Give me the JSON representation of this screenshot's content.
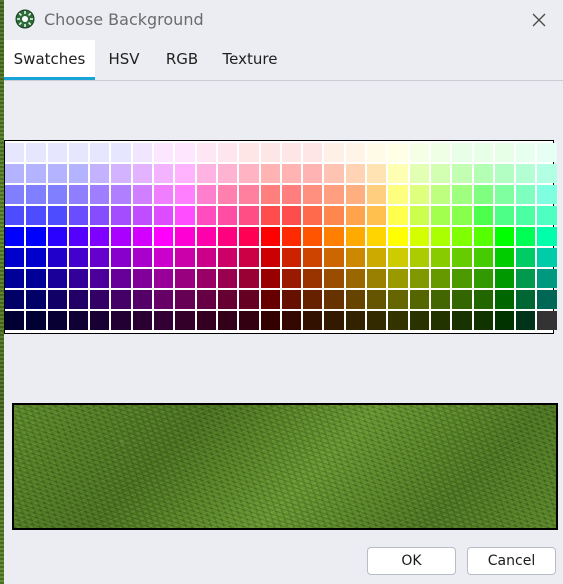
{
  "window": {
    "title": "Choose Background",
    "icon": "gear-app-icon",
    "close_icon": "close-icon"
  },
  "tabs": [
    {
      "label": "Swatches",
      "active": true
    },
    {
      "label": "HSV",
      "active": false
    },
    {
      "label": "RGB",
      "active": false
    },
    {
      "label": "Texture",
      "active": false
    }
  ],
  "swatches": {
    "rows": 9,
    "columns": 26,
    "colors": [
      [
        "#e6e6ff",
        "#e6e6ff",
        "#e6e6ff",
        "#e6e6ff",
        "#e6e6ff",
        "#e6e6ff",
        "#f0e6ff",
        "#fde6ff",
        "#ffe6ff",
        "#ffe6f5",
        "#ffe6ee",
        "#ffe6e6",
        "#ffe6e6",
        "#ffe6e6",
        "#ffe6e6",
        "#fff0e6",
        "#fff5e6",
        "#fffbe6",
        "#ffffe6",
        "#f5ffe6",
        "#eeffe6",
        "#e6ffe6",
        "#e6ffe6",
        "#e6ffe6",
        "#e6ffee",
        "#e6fff5"
      ],
      [
        "#b3b3ff",
        "#b3b3ff",
        "#b3b3ff",
        "#b3b3ff",
        "#c3b3ff",
        "#d3b3ff",
        "#e3b3ff",
        "#f3b3ff",
        "#ffb3ff",
        "#ffb3e3",
        "#ffb3d3",
        "#ffb3c3",
        "#ffb3b3",
        "#ffb3b3",
        "#ffb3b3",
        "#ffc3b3",
        "#ffd3b3",
        "#ffe3b3",
        "#ffffb3",
        "#e3ffb3",
        "#d3ffb3",
        "#c3ffb3",
        "#b3ffb3",
        "#b3ffc3",
        "#b3ffd3",
        "#b3ffe3"
      ],
      [
        "#7f7fff",
        "#7f7fff",
        "#7f7fff",
        "#8f7fff",
        "#9f7fff",
        "#af7fff",
        "#cf7fff",
        "#ef7fff",
        "#ff7fff",
        "#ff7fcf",
        "#ff7faf",
        "#ff7f9f",
        "#ff7f7f",
        "#ff7f7f",
        "#ff8f7f",
        "#ff9f7f",
        "#ffaf7f",
        "#ffcf7f",
        "#ffff7f",
        "#dfff7f",
        "#bfff7f",
        "#9fff7f",
        "#7fff7f",
        "#7fff9f",
        "#7fffbf",
        "#7fffdf"
      ],
      [
        "#4d4dff",
        "#4d4dff",
        "#4d4dff",
        "#6a4dff",
        "#864dff",
        "#a34dff",
        "#c04dff",
        "#dd4dff",
        "#ff4dff",
        "#ff4dc0",
        "#ff4da3",
        "#ff4d86",
        "#ff4d4d",
        "#ff4d4d",
        "#ff6a4d",
        "#ff864d",
        "#ffa34d",
        "#ffc04d",
        "#ffff4d",
        "#ccff4d",
        "#a3ff4d",
        "#86ff4d",
        "#4dff4d",
        "#4dff86",
        "#4dffa3",
        "#4dffc0"
      ],
      [
        "#0000ff",
        "#0000ff",
        "#2a00ff",
        "#5500ff",
        "#7f00ff",
        "#aa00ff",
        "#d400ff",
        "#ff00ff",
        "#ff00d4",
        "#ff00aa",
        "#ff007f",
        "#ff0055",
        "#ff0000",
        "#ff2a00",
        "#ff5500",
        "#ff7f00",
        "#ffaa00",
        "#ffd400",
        "#ffff00",
        "#d4ff00",
        "#aaff00",
        "#7fff00",
        "#55ff00",
        "#00ff00",
        "#00ff55",
        "#00ffaa"
      ],
      [
        "#0000cc",
        "#0000cc",
        "#2200cc",
        "#4400cc",
        "#6600cc",
        "#8800cc",
        "#aa00cc",
        "#cc00cc",
        "#cc00aa",
        "#cc0088",
        "#cc0066",
        "#cc0044",
        "#cc0000",
        "#cc2200",
        "#cc4400",
        "#cc6600",
        "#cc8800",
        "#ccaa00",
        "#cccc00",
        "#aacc00",
        "#88cc00",
        "#66cc00",
        "#44cc00",
        "#00cc00",
        "#00cc66",
        "#00ccaa"
      ],
      [
        "#000099",
        "#000099",
        "#1a0099",
        "#330099",
        "#4d0099",
        "#660099",
        "#800099",
        "#990099",
        "#990080",
        "#990066",
        "#99004d",
        "#990033",
        "#990000",
        "#991a00",
        "#993300",
        "#994d00",
        "#996600",
        "#998000",
        "#999900",
        "#809900",
        "#669900",
        "#4d9900",
        "#339900",
        "#009900",
        "#00994d",
        "#009980"
      ],
      [
        "#000066",
        "#000066",
        "#110066",
        "#220066",
        "#330066",
        "#440066",
        "#550066",
        "#660066",
        "#660055",
        "#660044",
        "#660033",
        "#660022",
        "#660000",
        "#661100",
        "#662200",
        "#663300",
        "#664400",
        "#665500",
        "#666600",
        "#556600",
        "#446600",
        "#336600",
        "#226600",
        "#006600",
        "#006633",
        "#006655"
      ],
      [
        "#000033",
        "#000033",
        "#080033",
        "#110033",
        "#190033",
        "#220033",
        "#2a0033",
        "#330033",
        "#33002a",
        "#330022",
        "#330019",
        "#330011",
        "#330000",
        "#330800",
        "#331100",
        "#331900",
        "#332200",
        "#332a00",
        "#333300",
        "#2a3300",
        "#223300",
        "#193300",
        "#113300",
        "#003300",
        "#003319",
        "#333333"
      ]
    ]
  },
  "buttons": {
    "ok": "OK",
    "cancel": "Cancel"
  }
}
